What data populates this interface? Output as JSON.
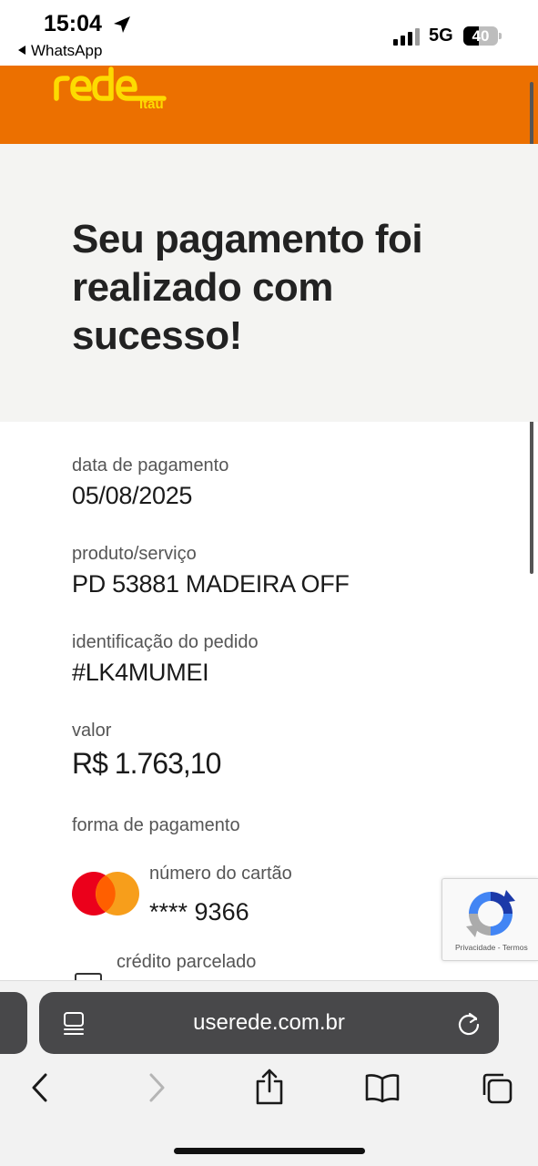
{
  "status_bar": {
    "time": "15:04",
    "back_app": "WhatsApp",
    "network": "5G",
    "battery": "40"
  },
  "brand": {
    "logo_text": "rede",
    "sub_text": "Itaú",
    "colors": {
      "header": "#ec7000",
      "logo": "#fddb00"
    }
  },
  "hero": {
    "title_lines": [
      "Seu pagamento foi",
      "realizado com",
      "sucesso!"
    ]
  },
  "details": {
    "payment_date_label": "data de pagamento",
    "payment_date": "05/08/2025",
    "product_label": "produto/serviço",
    "product": "PD 53881 MADEIRA OFF",
    "order_label": "identificação do pedido",
    "order_id": "#LK4MUMEI",
    "amount_label": "valor",
    "amount": "R$ 1.763,10",
    "payment_method_label": "forma de pagamento",
    "card_number_label": "número do cartão",
    "card_number": "**** 9366",
    "credit_label": "crédito parcelado"
  },
  "recaptcha": {
    "privacy": "Privacidade",
    "separator": " - ",
    "terms": "Termos"
  },
  "browser": {
    "url": "userede.com.br",
    "icons": [
      "reader-icon",
      "reload-icon",
      "back-icon",
      "forward-icon",
      "share-icon",
      "bookmarks-icon",
      "tabs-icon"
    ]
  }
}
